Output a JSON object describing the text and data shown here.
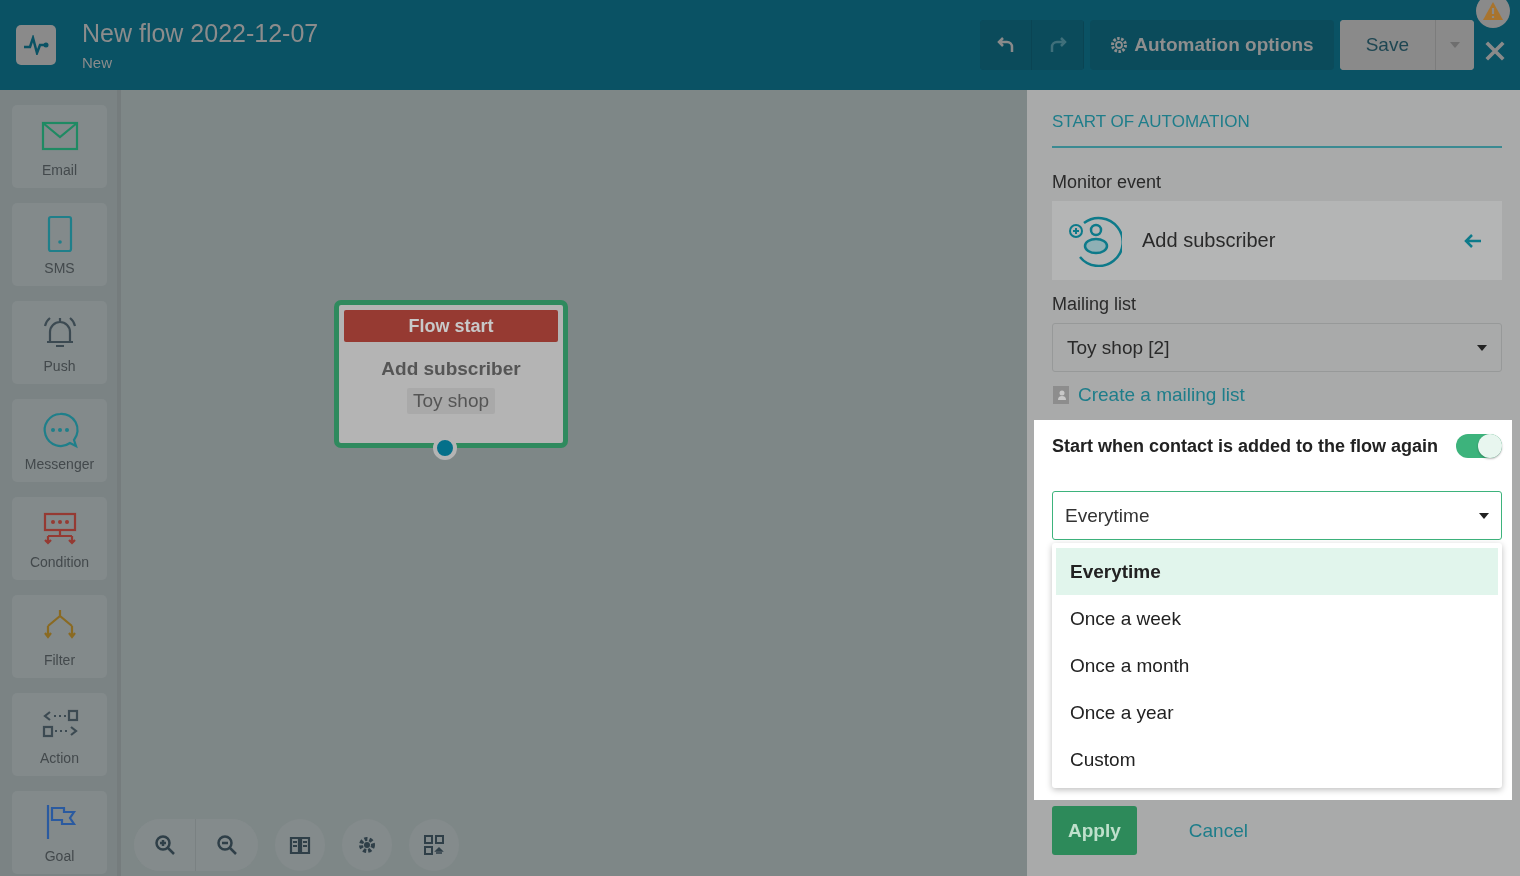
{
  "header": {
    "title": "New flow 2022-12-07",
    "subtitle": "New",
    "automation_options": "Automation options",
    "save": "Save",
    "warning": true
  },
  "sidebar": {
    "items": [
      {
        "kind": "email",
        "label": "Email",
        "color": "#1f8a63"
      },
      {
        "kind": "sms",
        "label": "SMS",
        "color": "#1f7f8a"
      },
      {
        "kind": "push",
        "label": "Push",
        "color": "#3c4a52"
      },
      {
        "kind": "messenger",
        "label": "Messenger",
        "color": "#1f7f8a"
      },
      {
        "kind": "condition",
        "label": "Condition",
        "color": "#953a33"
      },
      {
        "kind": "filter",
        "label": "Filter",
        "color": "#8a6a22"
      },
      {
        "kind": "action",
        "label": "Action",
        "color": "#3c4a52"
      },
      {
        "kind": "goal",
        "label": "Goal",
        "color": "#2a5aa0"
      }
    ]
  },
  "node": {
    "header": "Flow start",
    "event": "Add subscriber",
    "list": "Toy shop"
  },
  "panel": {
    "section_title": "START OF AUTOMATION",
    "monitor_event": {
      "label": "Monitor event",
      "value": "Add subscriber"
    },
    "mailing_list": {
      "label": "Mailing list",
      "value": "Toy shop [2]"
    },
    "create_link": "Create a mailing list",
    "toggle": {
      "label": "Start when contact is added to the flow again",
      "on": true
    },
    "frequency": {
      "value": "Everytime",
      "expanded": true,
      "options": [
        {
          "label": "Everytime",
          "selected": true
        },
        {
          "label": "Once a week",
          "selected": false
        },
        {
          "label": "Once a month",
          "selected": false
        },
        {
          "label": "Once a year",
          "selected": false
        },
        {
          "label": "Custom",
          "selected": false
        }
      ]
    },
    "apply": "Apply",
    "cancel": "Cancel"
  }
}
